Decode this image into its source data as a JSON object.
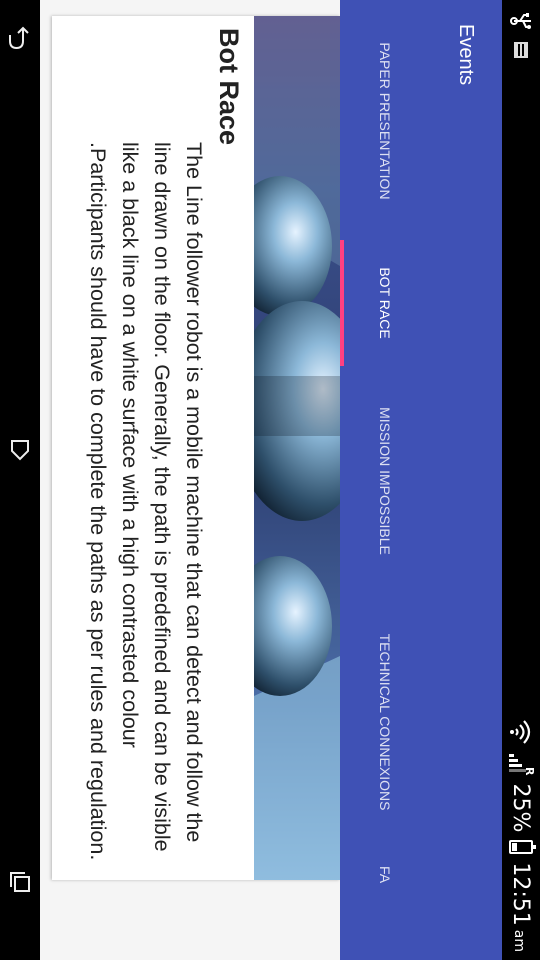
{
  "status_bar": {
    "battery_percent": "25%",
    "time": "12:51",
    "ampm": "am",
    "signal_label": "R",
    "icons": [
      "usb-icon",
      "notification-icon",
      "wifi-icon",
      "signal-icon",
      "battery-icon"
    ]
  },
  "app_bar": {
    "title": "Events"
  },
  "tabs": [
    {
      "label": "PAPER PRESENTATION",
      "selected": false
    },
    {
      "label": "BOT RACE",
      "selected": true
    },
    {
      "label": "MISSION IMPOSSIBLE",
      "selected": false
    },
    {
      "label": "TECHNICAL CONNEXIONS",
      "selected": false
    },
    {
      "label": "FA",
      "selected": false
    }
  ],
  "event": {
    "title": "Bot Race",
    "description": "The Line follower robot is a mobile machine that can detect and follow the line drawn on the floor. Generally, the path is predefined and can be visible like a black line on a white surface with a high contrasted colour .Participants should have to complete the paths as per rules and regulation."
  },
  "nav_bar": {
    "icons": [
      "back-icon",
      "home-icon",
      "recents-icon"
    ]
  },
  "colors": {
    "primary": "#3f51b5",
    "accent": "#ff4081",
    "background": "#f5f5f5"
  }
}
